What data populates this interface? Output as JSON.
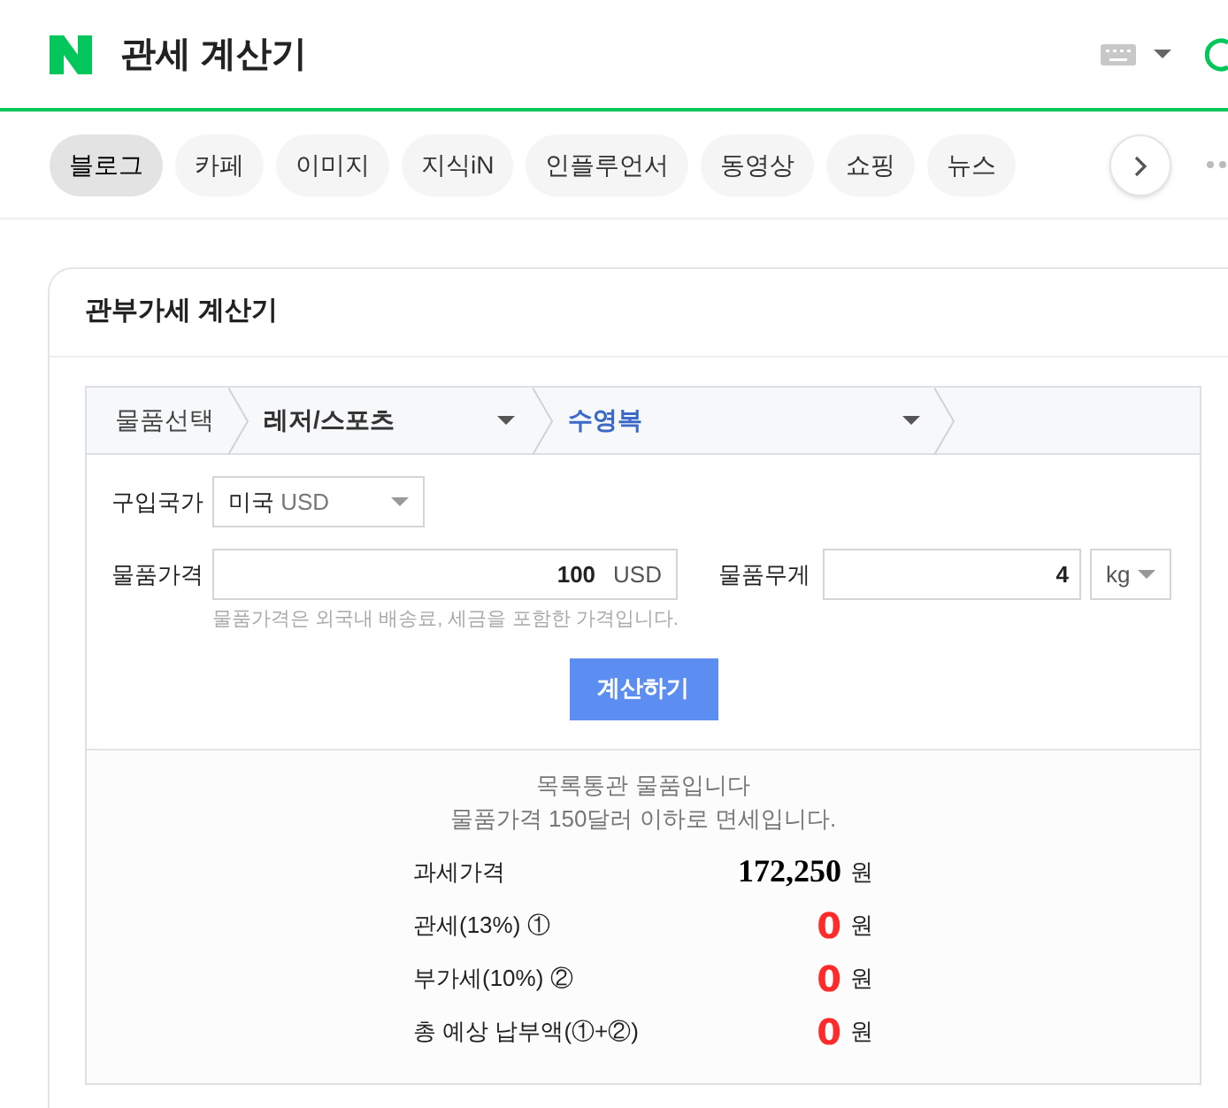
{
  "header": {
    "title": "관세 계산기"
  },
  "tabs": [
    {
      "label": "블로그",
      "selected": true
    },
    {
      "label": "카페",
      "selected": false
    },
    {
      "label": "이미지",
      "selected": false
    },
    {
      "label": "지식iN",
      "selected": false
    },
    {
      "label": "인플루언서",
      "selected": false
    },
    {
      "label": "동영상",
      "selected": false
    },
    {
      "label": "쇼핑",
      "selected": false
    },
    {
      "label": "뉴스",
      "selected": false
    }
  ],
  "card": {
    "title": "관부가세 계산기"
  },
  "breadcrumb": {
    "label": "물품선택",
    "category": "레저/스포츠",
    "item": "수영복"
  },
  "form": {
    "country": {
      "label": "구입국가",
      "value": "미국",
      "currency": "USD"
    },
    "price": {
      "label": "물품가격",
      "value": "100",
      "unit": "USD",
      "hint": "물품가격은 외국내 배송료, 세금을 포함한 가격입니다."
    },
    "weight": {
      "label": "물품무게",
      "value": "4",
      "unit": "kg"
    },
    "button": "계산하기"
  },
  "result": {
    "messages": [
      "목록통관 물품입니다",
      "물품가격 150달러 이하로 면세입니다."
    ],
    "rows": [
      {
        "label": "과세가격",
        "value": "172,250",
        "unit": "원",
        "kind": "base"
      },
      {
        "label": "관세(13%) ①",
        "value": "0",
        "unit": "원",
        "kind": "tax"
      },
      {
        "label": "부가세(10%) ②",
        "value": "0",
        "unit": "원",
        "kind": "tax"
      },
      {
        "label": "총 예상 납부액(①+②)",
        "value": "0",
        "unit": "원",
        "kind": "tax"
      }
    ]
  }
}
